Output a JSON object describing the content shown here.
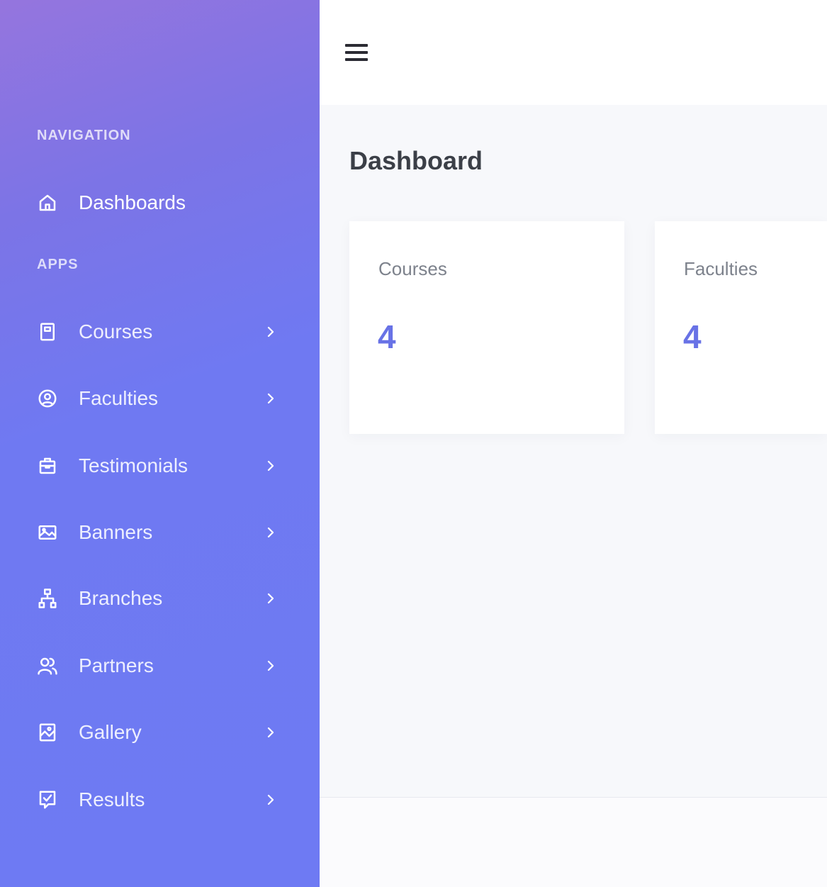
{
  "sidebar": {
    "sections": {
      "navigation": "NAVIGATION",
      "apps": "APPS"
    },
    "dashboard_item": {
      "label": "Dashboards",
      "icon": "home-icon"
    },
    "items": [
      {
        "label": "Courses",
        "icon": "book-icon"
      },
      {
        "label": "Faculties",
        "icon": "user-circle-icon"
      },
      {
        "label": "Testimonials",
        "icon": "briefcase-icon"
      },
      {
        "label": "Banners",
        "icon": "image-icon"
      },
      {
        "label": "Branches",
        "icon": "sitemap-icon"
      },
      {
        "label": "Partners",
        "icon": "users-icon"
      },
      {
        "label": "Gallery",
        "icon": "gallery-icon"
      },
      {
        "label": "Results",
        "icon": "check-square-icon"
      }
    ]
  },
  "header": {
    "menu_icon": "hamburger-icon"
  },
  "main": {
    "title": "Dashboard",
    "cards": [
      {
        "title": "Courses",
        "value": "4"
      },
      {
        "title": "Faculties",
        "value": "4"
      }
    ]
  },
  "colors": {
    "sidebar_gradient_start": "#9575de",
    "sidebar_gradient_end": "#6e7af3",
    "accent": "#6872e6"
  }
}
